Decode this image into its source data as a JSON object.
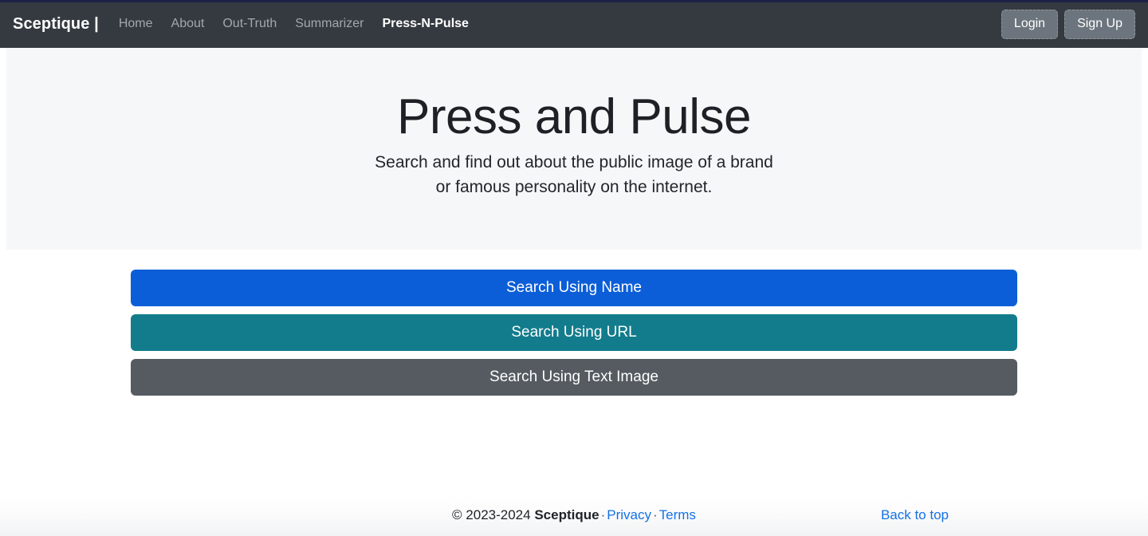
{
  "navbar": {
    "brand": "Sceptique |",
    "links": [
      {
        "label": "Home",
        "active": false
      },
      {
        "label": "About",
        "active": false
      },
      {
        "label": "Out-Truth",
        "active": false
      },
      {
        "label": "Summarizer",
        "active": false
      },
      {
        "label": "Press-N-Pulse",
        "active": true
      }
    ],
    "login_label": "Login",
    "signup_label": "Sign Up",
    "background_color": "#343a40"
  },
  "hero": {
    "title": "Press and Pulse",
    "subtitle": "Search and find out about the public image of a brand or famous personality on the internet.",
    "subtitle_line1": "Search and find out about the public image of a brand",
    "subtitle_line2": "or famous personality on the internet.",
    "background_color": "#f6f7f9"
  },
  "actions": {
    "buttons": [
      {
        "label": "Search Using Name",
        "color": "#0b5ed7"
      },
      {
        "label": "Search Using URL",
        "color": "#127c8c"
      },
      {
        "label": "Search Using Text Image",
        "color": "#555b61"
      }
    ]
  },
  "footer": {
    "copyright_prefix": "© 2023-2024 ",
    "brand": "Sceptique",
    "separator": "·",
    "privacy_label": "Privacy",
    "terms_label": "Terms",
    "back_to_top_label": "Back to top",
    "link_color": "#1472e6"
  }
}
